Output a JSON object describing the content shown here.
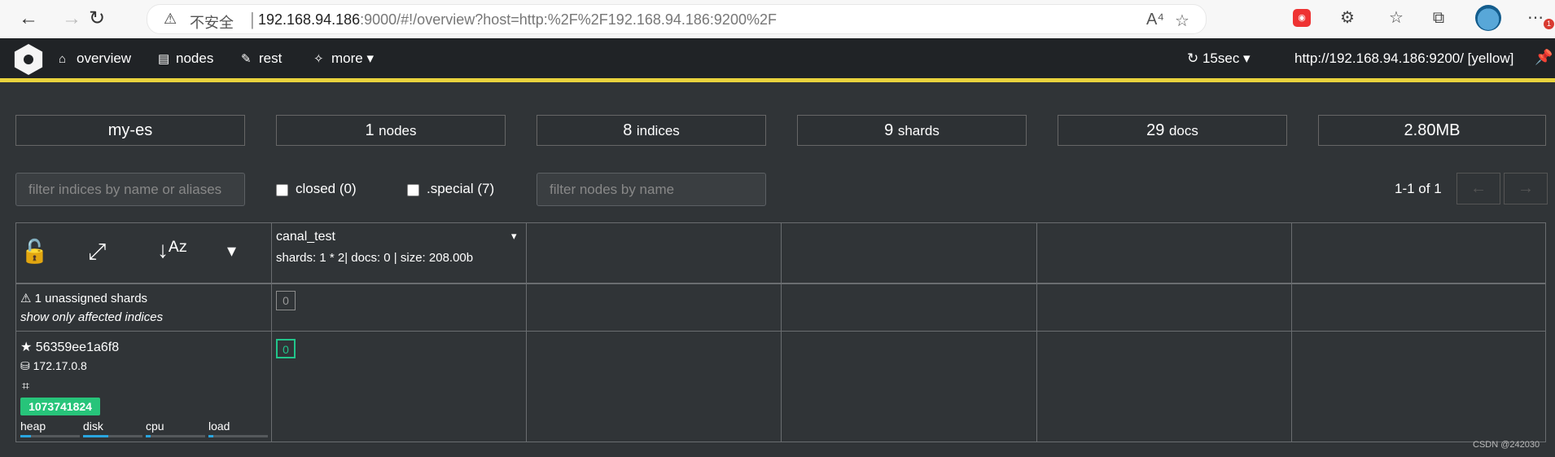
{
  "browser": {
    "back": "←",
    "forward": "→",
    "reload": "↻",
    "warning": "⚠",
    "insecure": "不安全",
    "separator": "|",
    "host": "192.168.94.186",
    "path": ":9000/#!/overview?host=http:%2F%2F192.168.94.186:9200%2F",
    "read_aloud": "A⁴",
    "favorite": "☆",
    "extension": "⚙",
    "more": "⋯",
    "notification_count": "1"
  },
  "app": {
    "nav": [
      {
        "icon": "⌂",
        "label": "overview"
      },
      {
        "icon": "▤",
        "label": "nodes"
      },
      {
        "icon": "✎",
        "label": "rest"
      },
      {
        "icon": "✧",
        "label": "more ▾"
      }
    ],
    "refresh": "↻ 15sec ▾",
    "cluster_url": "http://192.168.94.186:9200/ [yellow]",
    "pin": "📌"
  },
  "summary": [
    {
      "value": "my-es",
      "unit": ""
    },
    {
      "value": "1",
      "unit": "nodes"
    },
    {
      "value": "8",
      "unit": "indices"
    },
    {
      "value": "9",
      "unit": "shards"
    },
    {
      "value": "29",
      "unit": "docs"
    },
    {
      "value": "2.80MB",
      "unit": ""
    }
  ],
  "filters": {
    "indices_placeholder": "filter indices by name or aliases",
    "closed_label": "closed (0)",
    "special_label": ".special (7)",
    "nodes_placeholder": "filter nodes by name",
    "pagination": "1-1 of 1",
    "prev": "←",
    "next": "→"
  },
  "grid": {
    "lock": "🔓",
    "expand": "⤢",
    "sort": "↓ᴬᶻ",
    "dropdown": "▾",
    "index_name": "canal_test",
    "index_stats": "shards: 1 * 2| docs: 0 | size: 208.00b",
    "unassigned_label": "⚠ 1 unassigned shards",
    "affected_label": "show only affected indices",
    "unassigned_shard": "0",
    "node_name": "★ 56359ee1a6f8",
    "node_ip": "⛁ 172.17.0.8",
    "crop": "⌗",
    "node_id": "1073741824",
    "assigned_shard": "0",
    "metrics": [
      {
        "label": "heap",
        "fill": 0.18
      },
      {
        "label": "disk",
        "fill": 0.42
      },
      {
        "label": "cpu",
        "fill": 0.08
      },
      {
        "label": "load",
        "fill": 0.08
      }
    ]
  },
  "watermark": "CSDN @242030",
  "colors": {
    "accent": "#e9d33d",
    "ok": "#27c47a",
    "bar": "#2aa5df"
  }
}
